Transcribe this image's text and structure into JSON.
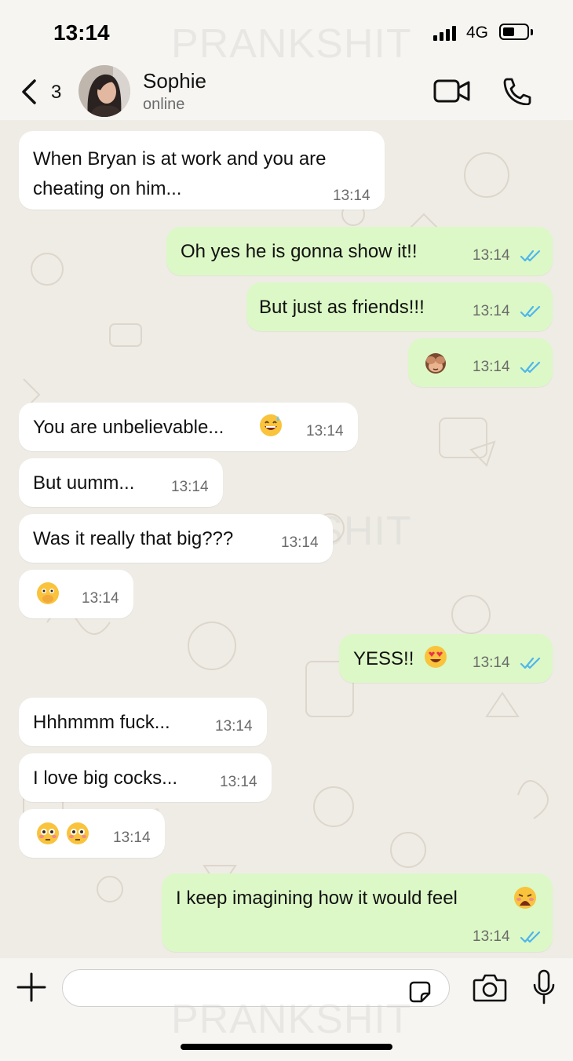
{
  "status_bar": {
    "time": "13:14",
    "network": "4G"
  },
  "watermark": "PRANKSHIT",
  "header": {
    "back_count": "3",
    "contact_name": "Sophie",
    "contact_status": "online"
  },
  "messages": [
    {
      "dir": "in",
      "lines": [
        "When Bryan is at work and you are",
        "cheating on him..."
      ],
      "time": "13:14"
    },
    {
      "dir": "out",
      "text": "Oh yes he is gonna show it!!",
      "time": "13:14",
      "read": true
    },
    {
      "dir": "out",
      "text": "But just as friends!!!",
      "time": "13:14",
      "read": true
    },
    {
      "dir": "out",
      "emoji": [
        "see-no-evil-monkey"
      ],
      "time": "13:14",
      "read": true
    },
    {
      "dir": "in",
      "text": "You are unbelievable...",
      "emoji": [
        "grinning-sweat-face"
      ],
      "time": "13:14"
    },
    {
      "dir": "in",
      "text": "But uumm...",
      "time": "13:14"
    },
    {
      "dir": "in",
      "text": "Was it really that big???",
      "time": "13:14"
    },
    {
      "dir": "in",
      "emoji": [
        "face-with-hand-over-mouth"
      ],
      "time": "13:14"
    },
    {
      "dir": "out",
      "text": "YESS!!",
      "emoji": [
        "heart-eyes-face"
      ],
      "time": "13:14",
      "read": true
    },
    {
      "dir": "in",
      "text": "Hhhmmm fuck...",
      "time": "13:14"
    },
    {
      "dir": "in",
      "text": "I love big cocks...",
      "time": "13:14"
    },
    {
      "dir": "in",
      "emoji": [
        "flushed-face",
        "flushed-face"
      ],
      "time": "13:14"
    },
    {
      "dir": "out",
      "text": "I keep imagining how it would feel",
      "emoji": [
        "weary-face"
      ],
      "time": "13:14",
      "read": true
    }
  ],
  "input": {
    "placeholder": ""
  },
  "colors": {
    "incoming_bubble": "#ffffff",
    "outgoing_bubble": "#dcf8c6",
    "read_ticks": "#4fb6ec",
    "chat_background": "#efece6"
  }
}
